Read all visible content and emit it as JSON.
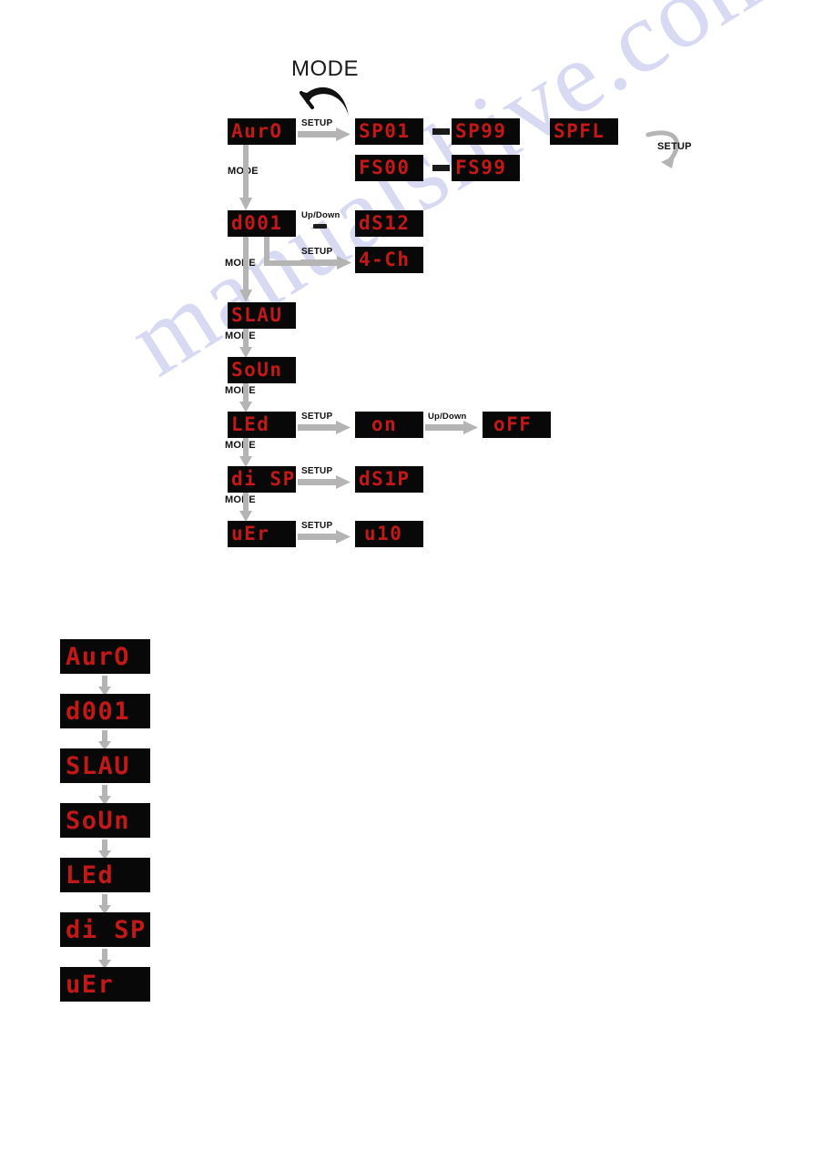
{
  "page": {
    "watermark": "manualshive.com",
    "colors": {
      "led_red": "#c21818",
      "led_bg": "#080808",
      "arrow_grey": "#b4b4b4",
      "text_black": "#111111",
      "watermark": "#b9bbe8"
    }
  },
  "top_title": {
    "mode_label": "MODE"
  },
  "flow": {
    "displays": {
      "auto": "AurO",
      "sp01": "SP01",
      "sp99": "SP99",
      "fs00": "FS00",
      "fs99": "FS99",
      "spfl": "SPFL",
      "d001": "d001",
      "ds12": "dS12",
      "ch4": "4-Ch",
      "slau": "SLAU",
      "soun": "SoUn",
      "led": "LEd",
      "on": "on",
      "off": "oFF",
      "disp": "di SP",
      "ds1p": "dS1P",
      "uer": "uEr",
      "u10": "u10"
    },
    "labels": {
      "setup_auto": "SETUP",
      "mode_auto": "MODE",
      "updown_d001": "Up/Down",
      "setup_d001": "SETUP",
      "mode_d001": "MODE",
      "mode_slau": "MODE",
      "mode_soun": "MODE",
      "setup_led": "SETUP",
      "updown_on": "Up/Down",
      "mode_led": "MODE",
      "setup_disp": "SETUP",
      "mode_disp": "MODE",
      "setup_uer": "SETUP",
      "setup_return": "SETUP"
    }
  },
  "sequence": {
    "items": [
      {
        "value": "AurO"
      },
      {
        "value": "d001"
      },
      {
        "value": "SLAU"
      },
      {
        "value": "SoUn"
      },
      {
        "value": "LEd"
      },
      {
        "value": "di SP"
      },
      {
        "value": "uEr"
      }
    ]
  }
}
